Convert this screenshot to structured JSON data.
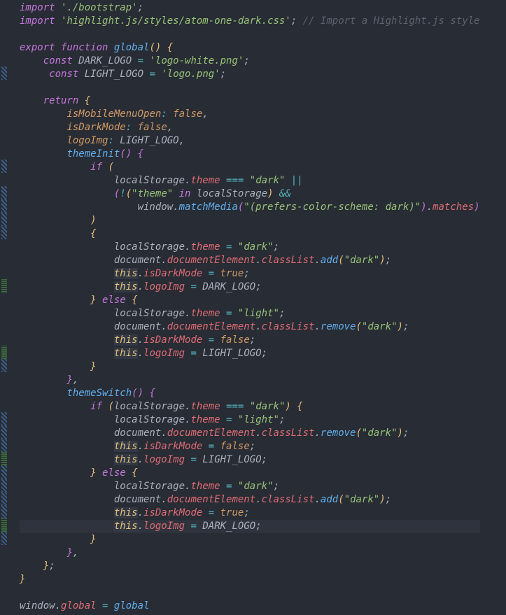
{
  "lines": [
    {
      "g": "",
      "segs": [
        [
          "kw",
          "import"
        ],
        [
          "pn",
          " "
        ],
        [
          "str",
          "'./bootstrap'"
        ],
        [
          "pn",
          ";"
        ]
      ]
    },
    {
      "g": "",
      "segs": [
        [
          "kw",
          "import"
        ],
        [
          "pn",
          " "
        ],
        [
          "str",
          "'highlight.js/styles/atom-one-dark.css'"
        ],
        [
          "pn",
          ";"
        ],
        [
          "pn",
          " "
        ],
        [
          "cmt",
          "// Import a Highlight.js style"
        ]
      ]
    },
    {
      "g": "",
      "segs": [
        [
          "pn",
          ""
        ]
      ]
    },
    {
      "g": "",
      "segs": [
        [
          "kw",
          "export"
        ],
        [
          "pn",
          " "
        ],
        [
          "kw",
          "function"
        ],
        [
          "pn",
          " "
        ],
        [
          "fn",
          "global"
        ],
        [
          "pny",
          "()"
        ],
        [
          "pn",
          " "
        ],
        [
          "pny",
          "{"
        ]
      ]
    },
    {
      "g": "",
      "segs": [
        [
          "pn",
          "    "
        ],
        [
          "kw",
          "const"
        ],
        [
          "pn",
          " DARK_LOGO "
        ],
        [
          "op",
          "="
        ],
        [
          "pn",
          " "
        ],
        [
          "str",
          "'logo-white.png'"
        ],
        [
          "pn",
          ";"
        ]
      ]
    },
    {
      "g": "mod",
      "segs": [
        [
          "pn",
          "     "
        ],
        [
          "kw",
          "const"
        ],
        [
          "pn",
          " LIGHT_LOGO "
        ],
        [
          "op",
          "="
        ],
        [
          "pn",
          " "
        ],
        [
          "str",
          "'logo.png'"
        ],
        [
          "pn",
          ";"
        ]
      ]
    },
    {
      "g": "",
      "segs": [
        [
          "pn",
          ""
        ]
      ]
    },
    {
      "g": "",
      "segs": [
        [
          "pn",
          "    "
        ],
        [
          "kw",
          "return"
        ],
        [
          "pn",
          " "
        ],
        [
          "pny",
          "{"
        ]
      ]
    },
    {
      "g": "",
      "segs": [
        [
          "pn",
          "        "
        ],
        [
          "attr",
          "isMobileMenuOpen"
        ],
        [
          "op",
          ":"
        ],
        [
          "pn",
          " "
        ],
        [
          "bool",
          "false"
        ],
        [
          "pn",
          ","
        ]
      ]
    },
    {
      "g": "",
      "segs": [
        [
          "pn",
          "        "
        ],
        [
          "attr",
          "isDarkMode"
        ],
        [
          "op",
          ":"
        ],
        [
          "pn",
          " "
        ],
        [
          "bool",
          "false"
        ],
        [
          "pn",
          ","
        ]
      ]
    },
    {
      "g": "",
      "segs": [
        [
          "pn",
          "        "
        ],
        [
          "attr",
          "logoImg"
        ],
        [
          "op",
          ":"
        ],
        [
          "pn",
          " LIGHT_LOGO"
        ],
        [
          "pn",
          ","
        ]
      ]
    },
    {
      "g": "",
      "segs": [
        [
          "pn",
          "        "
        ],
        [
          "fn",
          "themeInit"
        ],
        [
          "pnr",
          "()"
        ],
        [
          "pn",
          " "
        ],
        [
          "pnr",
          "{"
        ]
      ]
    },
    {
      "g": "mod",
      "segs": [
        [
          "pn",
          "            "
        ],
        [
          "kw",
          "if"
        ],
        [
          "pn",
          " "
        ],
        [
          "pny",
          "("
        ]
      ]
    },
    {
      "g": "",
      "segs": [
        [
          "pn",
          "                localStorage"
        ],
        [
          "pn",
          "."
        ],
        [
          "prop",
          "theme"
        ],
        [
          "pn",
          " "
        ],
        [
          "op",
          "==="
        ],
        [
          "pn",
          " "
        ],
        [
          "str",
          "\"dark\""
        ],
        [
          "pn",
          " "
        ],
        [
          "op",
          "||"
        ]
      ]
    },
    {
      "g": "mod",
      "segs": [
        [
          "pn",
          "                "
        ],
        [
          "pnr",
          "("
        ],
        [
          "op",
          "!"
        ],
        [
          "pny",
          "("
        ],
        [
          "str",
          "\"theme\""
        ],
        [
          "pn",
          " "
        ],
        [
          "kw",
          "in"
        ],
        [
          "pn",
          " localStorage"
        ],
        [
          "pny",
          ")"
        ],
        [
          "pn",
          " "
        ],
        [
          "op",
          "&&"
        ]
      ]
    },
    {
      "g": "mod",
      "segs": [
        [
          "pn",
          "                    window"
        ],
        [
          "pn",
          "."
        ],
        [
          "fn",
          "matchMedia"
        ],
        [
          "pnr",
          "("
        ],
        [
          "str",
          "\"(prefers-color-scheme: dark)\""
        ],
        [
          "pnr",
          ")"
        ],
        [
          "pn",
          "."
        ],
        [
          "prop",
          "matches"
        ],
        [
          "pnr",
          ")"
        ]
      ]
    },
    {
      "g": "mod",
      "segs": [
        [
          "pn",
          "            "
        ],
        [
          "pny",
          ")"
        ]
      ]
    },
    {
      "g": "mod",
      "segs": [
        [
          "pn",
          "            "
        ],
        [
          "pny",
          "{"
        ]
      ]
    },
    {
      "g": "",
      "segs": [
        [
          "pn",
          "                localStorage"
        ],
        [
          "pn",
          "."
        ],
        [
          "prop",
          "theme"
        ],
        [
          "pn",
          " "
        ],
        [
          "op",
          "="
        ],
        [
          "pn",
          " "
        ],
        [
          "str",
          "\"dark\""
        ],
        [
          "pn",
          ";"
        ]
      ]
    },
    {
      "g": "",
      "segs": [
        [
          "pn",
          "                document"
        ],
        [
          "pn",
          "."
        ],
        [
          "prop",
          "documentElement"
        ],
        [
          "pn",
          "."
        ],
        [
          "prop",
          "classList"
        ],
        [
          "pn",
          "."
        ],
        [
          "fn",
          "add"
        ],
        [
          "pny",
          "("
        ],
        [
          "str",
          "\"dark\""
        ],
        [
          "pny",
          ")"
        ],
        [
          "pn",
          ";"
        ]
      ]
    },
    {
      "g": "",
      "segs": [
        [
          "pn",
          "                "
        ],
        [
          "this",
          "this"
        ],
        [
          "pn",
          "."
        ],
        [
          "prop",
          "isDarkMode"
        ],
        [
          "pn",
          " "
        ],
        [
          "op",
          "="
        ],
        [
          "pn",
          " "
        ],
        [
          "bool",
          "true"
        ],
        [
          "pn",
          ";"
        ]
      ]
    },
    {
      "g": "add",
      "segs": [
        [
          "pn",
          "                "
        ],
        [
          "this",
          "this"
        ],
        [
          "pn",
          "."
        ],
        [
          "prop",
          "logoImg"
        ],
        [
          "pn",
          " "
        ],
        [
          "op",
          "="
        ],
        [
          "pn",
          " DARK_LOGO"
        ],
        [
          "pn",
          ";"
        ]
      ]
    },
    {
      "g": "",
      "segs": [
        [
          "pn",
          "            "
        ],
        [
          "pny",
          "}"
        ],
        [
          "pn",
          " "
        ],
        [
          "kw",
          "else"
        ],
        [
          "pn",
          " "
        ],
        [
          "pny",
          "{"
        ]
      ]
    },
    {
      "g": "",
      "segs": [
        [
          "pn",
          "                localStorage"
        ],
        [
          "pn",
          "."
        ],
        [
          "prop",
          "theme"
        ],
        [
          "pn",
          " "
        ],
        [
          "op",
          "="
        ],
        [
          "pn",
          " "
        ],
        [
          "str",
          "\"light\""
        ],
        [
          "pn",
          ";"
        ]
      ]
    },
    {
      "g": "",
      "segs": [
        [
          "pn",
          "                document"
        ],
        [
          "pn",
          "."
        ],
        [
          "prop",
          "documentElement"
        ],
        [
          "pn",
          "."
        ],
        [
          "prop",
          "classList"
        ],
        [
          "pn",
          "."
        ],
        [
          "fn",
          "remove"
        ],
        [
          "pny",
          "("
        ],
        [
          "str",
          "\"dark\""
        ],
        [
          "pny",
          ")"
        ],
        [
          "pn",
          ";"
        ]
      ]
    },
    {
      "g": "",
      "segs": [
        [
          "pn",
          "                "
        ],
        [
          "this",
          "this"
        ],
        [
          "pn",
          "."
        ],
        [
          "prop",
          "isDarkMode"
        ],
        [
          "pn",
          " "
        ],
        [
          "op",
          "="
        ],
        [
          "pn",
          " "
        ],
        [
          "bool",
          "false"
        ],
        [
          "pn",
          ";"
        ]
      ]
    },
    {
      "g": "add",
      "segs": [
        [
          "pn",
          "                "
        ],
        [
          "this",
          "this"
        ],
        [
          "pn",
          "."
        ],
        [
          "prop",
          "logoImg"
        ],
        [
          "pn",
          " "
        ],
        [
          "op",
          "="
        ],
        [
          "pn",
          " LIGHT_LOGO"
        ],
        [
          "pn",
          ";"
        ]
      ]
    },
    {
      "g": "mod",
      "segs": [
        [
          "pn",
          "            "
        ],
        [
          "pny",
          "}"
        ]
      ]
    },
    {
      "g": "",
      "segs": [
        [
          "pn",
          "        "
        ],
        [
          "pnr",
          "}"
        ],
        [
          "pn",
          ","
        ]
      ]
    },
    {
      "g": "",
      "segs": [
        [
          "pn",
          "        "
        ],
        [
          "fn",
          "themeSwitch"
        ],
        [
          "pnr",
          "()"
        ],
        [
          "pn",
          " "
        ],
        [
          "pnr",
          "{"
        ]
      ]
    },
    {
      "g": "",
      "segs": [
        [
          "pn",
          "            "
        ],
        [
          "kw",
          "if"
        ],
        [
          "pn",
          " "
        ],
        [
          "pny",
          "("
        ],
        [
          "pn",
          "localStorage"
        ],
        [
          "pn",
          "."
        ],
        [
          "prop",
          "theme"
        ],
        [
          "pn",
          " "
        ],
        [
          "op",
          "==="
        ],
        [
          "pn",
          " "
        ],
        [
          "str",
          "\"dark\""
        ],
        [
          "pny",
          ")"
        ],
        [
          "pn",
          " "
        ],
        [
          "pny",
          "{"
        ]
      ]
    },
    {
      "g": "mod",
      "segs": [
        [
          "pn",
          "                localStorage"
        ],
        [
          "pn",
          "."
        ],
        [
          "prop",
          "theme"
        ],
        [
          "pn",
          " "
        ],
        [
          "op",
          "="
        ],
        [
          "pn",
          " "
        ],
        [
          "str",
          "\"light\""
        ],
        [
          "pn",
          ";"
        ]
      ]
    },
    {
      "g": "mod",
      "segs": [
        [
          "pn",
          "                document"
        ],
        [
          "pn",
          "."
        ],
        [
          "prop",
          "documentElement"
        ],
        [
          "pn",
          "."
        ],
        [
          "prop",
          "classList"
        ],
        [
          "pn",
          "."
        ],
        [
          "fn",
          "remove"
        ],
        [
          "pny",
          "("
        ],
        [
          "str",
          "\"dark\""
        ],
        [
          "pny",
          ")"
        ],
        [
          "pn",
          ";"
        ]
      ]
    },
    {
      "g": "mod",
      "segs": [
        [
          "pn",
          "                "
        ],
        [
          "this",
          "this"
        ],
        [
          "pn",
          "."
        ],
        [
          "prop",
          "isDarkMode"
        ],
        [
          "pn",
          " "
        ],
        [
          "op",
          "="
        ],
        [
          "pn",
          " "
        ],
        [
          "bool",
          "false"
        ],
        [
          "pn",
          ";"
        ]
      ]
    },
    {
      "g": "add",
      "segs": [
        [
          "pn",
          "                "
        ],
        [
          "this",
          "this"
        ],
        [
          "pn",
          "."
        ],
        [
          "prop",
          "logoImg"
        ],
        [
          "pn",
          " "
        ],
        [
          "op",
          "="
        ],
        [
          "pn",
          " LIGHT_LOGO"
        ],
        [
          "pn",
          ";"
        ]
      ]
    },
    {
      "g": "mod",
      "segs": [
        [
          "pn",
          "            "
        ],
        [
          "pny",
          "}"
        ],
        [
          "pn",
          " "
        ],
        [
          "kw",
          "else"
        ],
        [
          "pn",
          " "
        ],
        [
          "pny",
          "{"
        ]
      ]
    },
    {
      "g": "mod",
      "segs": [
        [
          "pn",
          "                localStorage"
        ],
        [
          "pn",
          "."
        ],
        [
          "prop",
          "theme"
        ],
        [
          "pn",
          " "
        ],
        [
          "op",
          "="
        ],
        [
          "pn",
          " "
        ],
        [
          "str",
          "\"dark\""
        ],
        [
          "pn",
          ";"
        ]
      ]
    },
    {
      "g": "mod",
      "segs": [
        [
          "pn",
          "                document"
        ],
        [
          "pn",
          "."
        ],
        [
          "prop",
          "documentElement"
        ],
        [
          "pn",
          "."
        ],
        [
          "prop",
          "classList"
        ],
        [
          "pn",
          "."
        ],
        [
          "fn",
          "add"
        ],
        [
          "pny",
          "("
        ],
        [
          "str",
          "\"dark\""
        ],
        [
          "pny",
          ")"
        ],
        [
          "pn",
          ";"
        ]
      ]
    },
    {
      "g": "mod",
      "segs": [
        [
          "pn",
          "                "
        ],
        [
          "this",
          "this"
        ],
        [
          "pn",
          "."
        ],
        [
          "prop",
          "isDarkMode"
        ],
        [
          "pn",
          " "
        ],
        [
          "op",
          "="
        ],
        [
          "pn",
          " "
        ],
        [
          "bool",
          "true"
        ],
        [
          "pn",
          ";"
        ]
      ]
    },
    {
      "g": "add",
      "cur": true,
      "segs": [
        [
          "pn",
          "                "
        ],
        [
          "this",
          "this"
        ],
        [
          "pn",
          "."
        ],
        [
          "prop",
          "logoImg"
        ],
        [
          "pn",
          " "
        ],
        [
          "op",
          "="
        ],
        [
          "pn",
          " DARK_LOGO"
        ],
        [
          "pn",
          ";"
        ]
      ]
    },
    {
      "g": "mod",
      "segs": [
        [
          "pn",
          "            "
        ],
        [
          "pny",
          "}"
        ]
      ]
    },
    {
      "g": "",
      "segs": [
        [
          "pn",
          "        "
        ],
        [
          "pnr",
          "}"
        ],
        [
          "pn",
          ","
        ]
      ]
    },
    {
      "g": "",
      "segs": [
        [
          "pn",
          "    "
        ],
        [
          "pny",
          "}"
        ],
        [
          "pn",
          ";"
        ]
      ]
    },
    {
      "g": "",
      "segs": [
        [
          "pny",
          "}"
        ]
      ]
    },
    {
      "g": "",
      "segs": [
        [
          "pn",
          ""
        ]
      ]
    },
    {
      "g": "",
      "segs": [
        [
          "pn",
          "window"
        ],
        [
          "pn",
          "."
        ],
        [
          "prop",
          "global"
        ],
        [
          "pn",
          " "
        ],
        [
          "op",
          "="
        ],
        [
          "pn",
          " "
        ],
        [
          "fn",
          "global"
        ]
      ]
    }
  ]
}
